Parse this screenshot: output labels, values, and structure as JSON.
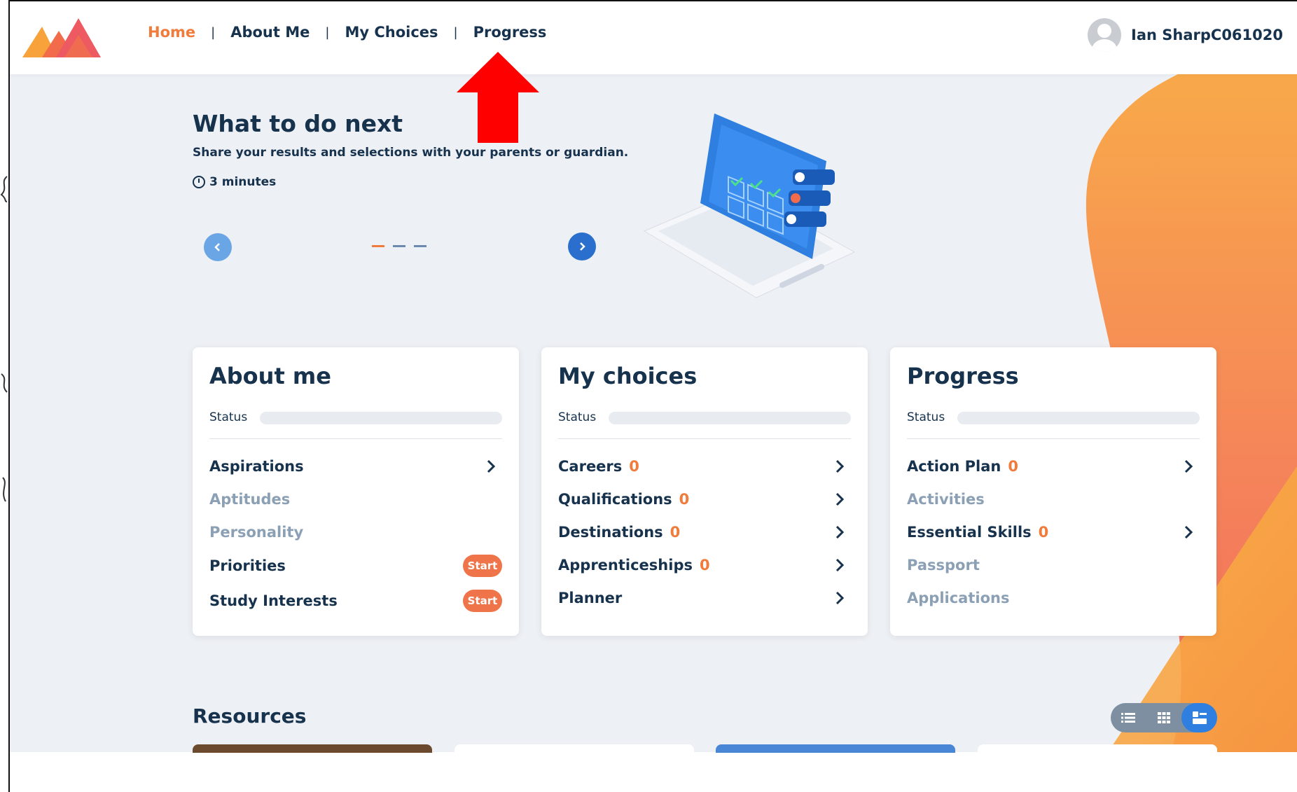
{
  "nav": {
    "items": [
      "Home",
      "About Me",
      "My Choices",
      "Progress"
    ],
    "separator": "|",
    "active": "Home"
  },
  "user": {
    "name": "Ian SharpC061020"
  },
  "hero": {
    "title": "What to do next",
    "subtitle": "Share your results and selections with your parents or guardian.",
    "duration": "3 minutes",
    "slides_total": 3,
    "slide_active": 1
  },
  "cards": [
    {
      "title": "About me",
      "status_label": "Status",
      "items": [
        {
          "label": "Aspirations",
          "count": "",
          "state": "link"
        },
        {
          "label": "Aptitudes",
          "count": "",
          "state": "disabled"
        },
        {
          "label": "Personality",
          "count": "",
          "state": "disabled"
        },
        {
          "label": "Priorities",
          "count": "",
          "state": "start",
          "badge": "Start"
        },
        {
          "label": "Study Interests",
          "count": "",
          "state": "start",
          "badge": "Start"
        }
      ]
    },
    {
      "title": "My choices",
      "status_label": "Status",
      "items": [
        {
          "label": "Careers",
          "count": "0",
          "state": "link"
        },
        {
          "label": "Qualifications",
          "count": "0",
          "state": "link"
        },
        {
          "label": "Destinations",
          "count": "0",
          "state": "link"
        },
        {
          "label": "Apprenticeships",
          "count": "0",
          "state": "link"
        },
        {
          "label": "Planner",
          "count": "",
          "state": "link"
        }
      ]
    },
    {
      "title": "Progress",
      "status_label": "Status",
      "items": [
        {
          "label": "Action Plan",
          "count": "0",
          "state": "link"
        },
        {
          "label": "Activities",
          "count": "",
          "state": "disabled"
        },
        {
          "label": "Essential Skills",
          "count": "0",
          "state": "link"
        },
        {
          "label": "Passport",
          "count": "",
          "state": "disabled"
        },
        {
          "label": "Applications",
          "count": "",
          "state": "disabled"
        }
      ]
    }
  ],
  "resources": {
    "title": "Resources",
    "views": [
      "list-view-icon",
      "grid-view-icon",
      "card-view-icon"
    ],
    "active_view": "card-view-icon"
  },
  "colors": {
    "accent": "#f07b3a",
    "navy": "#17324d",
    "primary_blue": "#2a6fce",
    "background": "#edf0f4",
    "annotation_arrow": "#ff0000"
  }
}
